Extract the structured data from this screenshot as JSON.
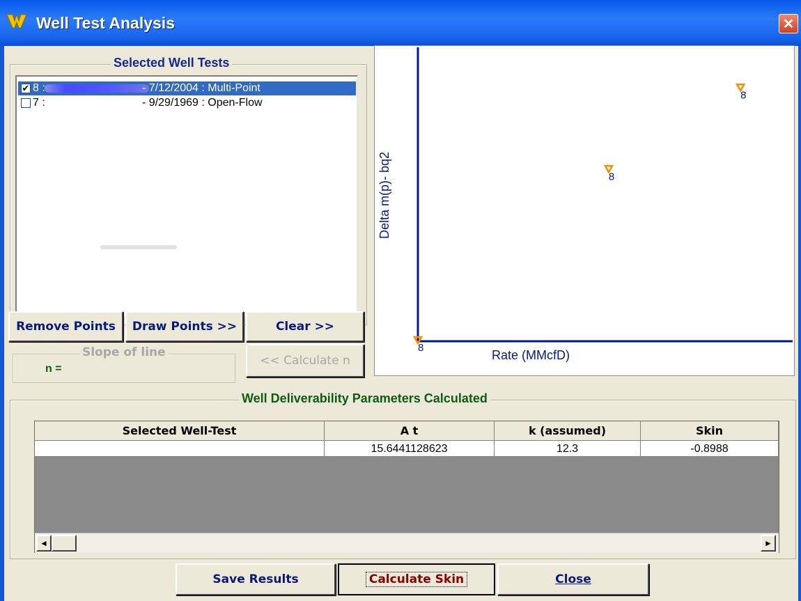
{
  "window": {
    "title": "Well Test Analysis"
  },
  "tests_group": {
    "title": "Selected Well Tests",
    "items": [
      {
        "checked": true,
        "id": "8 :",
        "desc": "- 7/12/2004 : Multi-Point"
      },
      {
        "checked": false,
        "id": "7 :",
        "desc": "- 9/29/1969 : Open-Flow"
      }
    ]
  },
  "buttons": {
    "remove_points": "Remove Points",
    "draw_points": "Draw Points >>",
    "clear": "Clear >>",
    "calculate_n": "<< Calculate n",
    "save_results": "Save Results",
    "calculate_skin": "Calculate Skin",
    "close": "Close"
  },
  "slope": {
    "title": "Slope of line",
    "n_label": "n ="
  },
  "chart_data": {
    "type": "scatter",
    "xlabel": "Rate (MMcfD)",
    "ylabel": "Delta m(p)- bq2",
    "series": [
      {
        "name": "8",
        "color": "#ff8c00",
        "points": [
          {
            "x": 0.0,
            "y": 0.0,
            "label": "8"
          },
          {
            "x": 0.55,
            "y": 0.63,
            "label": "8"
          },
          {
            "x": 0.93,
            "y": 0.93,
            "label": "8"
          }
        ]
      }
    ],
    "xlim": [
      0,
      1
    ],
    "ylim": [
      0,
      1
    ]
  },
  "results": {
    "title": "Well Deliverability Parameters Calculated",
    "columns": [
      "Selected Well-Test",
      "A t",
      "k (assumed)",
      "Skin"
    ],
    "rows": [
      [
        "",
        "15.6441128623",
        "12.3",
        "-0.8988"
      ]
    ]
  },
  "scroll": {
    "left": "◄",
    "right": "►"
  }
}
